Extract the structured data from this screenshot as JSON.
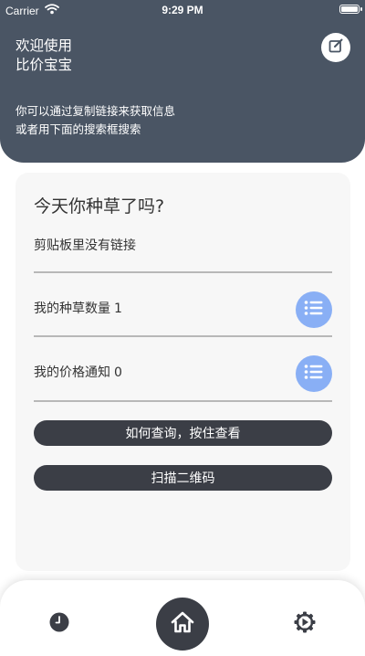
{
  "status_bar": {
    "carrier": "Carrier",
    "time": "9:29 PM"
  },
  "header": {
    "welcome_line1": "欢迎使用",
    "welcome_line2": "比价宝宝",
    "intro_line1": "你可以通过复制链接来获取信息",
    "intro_line2": "或者用下面的搜索框搜索",
    "edit_icon": "edit-icon",
    "background_color": "#4a5564"
  },
  "card": {
    "title": "今天你种草了吗?",
    "clipboard_status": "剪贴板里没有链接",
    "grass_label": "我的种草数量",
    "grass_count": "1",
    "price_label": "我的价格通知",
    "price_count": "0",
    "list_icon": "list-icon",
    "list_icon_color": "#89aff5"
  },
  "buttons": {
    "how_to_query": "如何查询，按住查看",
    "scan_qr": "扫描二维码",
    "button_color": "#3b3e46"
  },
  "bottom_nav": {
    "items": [
      "history-icon",
      "home-icon",
      "settings-icon"
    ],
    "active": "home-icon"
  }
}
